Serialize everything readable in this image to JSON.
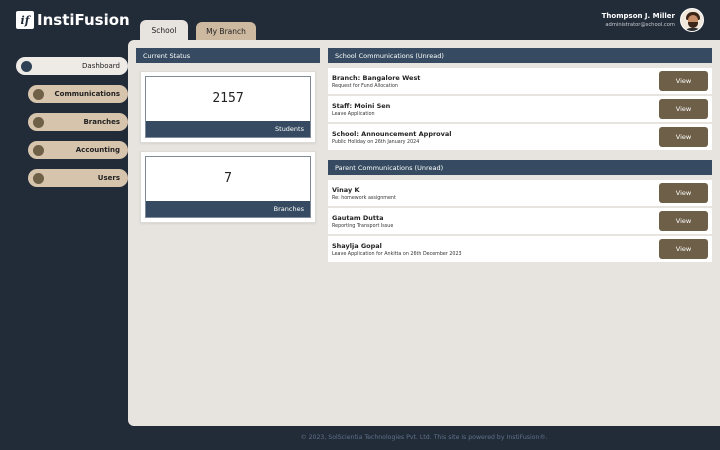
{
  "header": {
    "logo_mark": "if",
    "logo_text": "InstiFusion",
    "user_name": "Thompson J. Miller",
    "user_email": "administrator@school.com",
    "avatar_icon": "user-avatar-icon"
  },
  "tabs": [
    {
      "label": "School",
      "active": true
    },
    {
      "label": "My Branch",
      "active": false
    }
  ],
  "sidebar": {
    "items": [
      {
        "label": "Dashboard",
        "active": true
      },
      {
        "label": "Communications",
        "active": false
      },
      {
        "label": "Branches",
        "active": false
      },
      {
        "label": "Accounting",
        "active": false
      },
      {
        "label": "Users",
        "active": false
      }
    ]
  },
  "status": {
    "title": "Current Status",
    "cards": [
      {
        "value": "2157",
        "label": "Students"
      },
      {
        "value": "7",
        "label": "Branches"
      }
    ]
  },
  "school_comms": {
    "title": "School Communications (Unread)",
    "items": [
      {
        "title": "Branch: Bangalore West",
        "subtitle": "Request for Fund Allocation",
        "button": "View"
      },
      {
        "title": "Staff: Moini Sen",
        "subtitle": "Leave Application",
        "button": "View"
      },
      {
        "title": "School: Announcement Approval",
        "subtitle": "Public Holiday on 26th January 2024",
        "button": "View"
      }
    ]
  },
  "parent_comms": {
    "title": "Parent Communications (Unread)",
    "items": [
      {
        "title": "Vinay K",
        "subtitle": "Re: homework assignment",
        "button": "View"
      },
      {
        "title": "Gautam Dutta",
        "subtitle": "Reporting Transport Issue",
        "button": "View"
      },
      {
        "title": "Shaylja Gopal",
        "subtitle": "Leave Application for Ankitta on 26th December 2023",
        "button": "View"
      }
    ]
  },
  "footer": {
    "text": "© 2023, SolScientia Technologies Pvt. Ltd. This site is powered by InstiFusion®."
  },
  "colors": {
    "background": "#222b38",
    "panel": "#e7e4e0",
    "header_bar": "#364b61",
    "button": "#6e5f48",
    "sidebar_item": "#d6c4ad"
  }
}
